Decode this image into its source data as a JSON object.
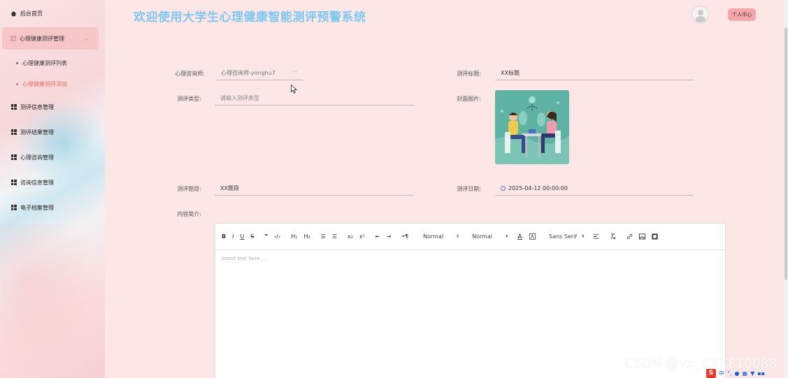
{
  "app": {
    "title": "欢迎使用大学生心理健康智能测评预警系统",
    "user_center": "个人中心"
  },
  "sidebar": {
    "home": "后台首页",
    "group": {
      "label": "心理健康测评管理",
      "children": [
        "心理健康测评列表",
        "心理健康测评添加"
      ],
      "active_child": "心理健康测评添加"
    },
    "items": [
      "测评信息管理",
      "测评结果管理",
      "心理咨询管理",
      "咨询信息管理",
      "电子档案管理"
    ]
  },
  "form": {
    "counselor": {
      "label": "心理咨询师:",
      "value": "心理咨询师-yonghu7"
    },
    "title": {
      "label": "测评标题:",
      "value": "XX标题"
    },
    "type": {
      "label": "测评类型:",
      "placeholder": "请输入测评类型"
    },
    "cover": {
      "label": "封面图片:"
    },
    "questions": {
      "label": "测评题目:",
      "value": "XX题目"
    },
    "date": {
      "label": "测评日期:",
      "value": "2025-04-12 00:00:00"
    },
    "intro": {
      "label": "内容简介:"
    }
  },
  "editor": {
    "toolbar": {
      "bold": "B",
      "italic": "I",
      "underline": "U",
      "strike": "S",
      "quote": "❞",
      "code": "‹/›",
      "h1": "H₁",
      "h2": "H₂",
      "ol": "☰",
      "ul": "☰",
      "sub": "x₂",
      "sup": "x²",
      "outdent": "⇤",
      "indent": "⇥",
      "rtl": "•¶",
      "size": "Normal",
      "header": "Normal",
      "font": "Sans Serif"
    },
    "placeholder": "Insert text here ..."
  },
  "watermark": "CSDN @vx_CXKF10088",
  "ime": {
    "logo": "S",
    "label": "中"
  },
  "colors": {
    "background": "#fde6e6",
    "title": "#7ec7f0",
    "accent": "#e06a6a",
    "user_button": "#f4a6ab"
  }
}
